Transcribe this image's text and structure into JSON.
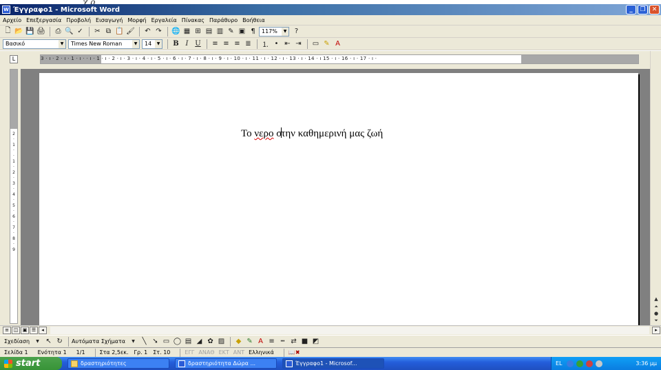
{
  "window": {
    "title": "Έγγραφο1 - Microsoft Word",
    "icon": "word-icon",
    "title_fragment": "χ  ρ"
  },
  "menu": [
    "Αρχείο",
    "Επεξεργασία",
    "Προβολή",
    "Εισαγωγή",
    "Μορφή",
    "Εργαλεία",
    "Πίνακας",
    "Παράθυρο",
    "Βοήθεια"
  ],
  "toolbar": {
    "zoom": "117%"
  },
  "formatting": {
    "style": "Βασικό",
    "font": "Times New Roman",
    "size": "14"
  },
  "ruler": {
    "ticks": "3 · ı · 2 · ı · 1 · ı ·   · ı · 1 · ı · 2 · ı · 3 · ı · 4 · ı · 5 · ı · 6 · ı · 7 · ı · 8 · ı · 9 · ı · 10 · ı · 11 · ı · 12 · ı · 13 · ı · 14 · ı   15 · ı · 16 · ı · 17 · ı ·",
    "vticks": [
      "2",
      "·",
      "1",
      "·",
      "·",
      "1",
      "·",
      "2",
      "·",
      "3",
      "·",
      "4",
      "·",
      "5",
      "·",
      "6",
      "·",
      "7",
      "·",
      "8",
      "·",
      "9"
    ]
  },
  "document": {
    "word1": "Το ",
    "word2": "νερο",
    "word3a": " σ",
    "word3b": "την καθημερινή μας ζωή"
  },
  "drawing": {
    "draw_label": "Σχεδίαση",
    "autoshapes_label": "Αυτόματα Σχήματα"
  },
  "status": {
    "page": "Σελίδα 1",
    "section": "Ενότητα 1",
    "pages": "1/1",
    "at": "Στα 2,5εκ.",
    "line": "Γρ. 1",
    "col": "Στ. 10",
    "rec": "ΕΓΓ",
    "trk": "ΑΝΑΘ",
    "ext": "ΕΚΤ",
    "ovr": "ΑΝΤ",
    "language": "Ελληνικά"
  },
  "taskbar": {
    "start": "start",
    "tasks": [
      "δραστηριότητες",
      "δραστηριότητα Δώρα ...",
      "Έγγραφο1 - Microsof..."
    ],
    "lang": "EL",
    "clock": "3:36 μμ"
  }
}
